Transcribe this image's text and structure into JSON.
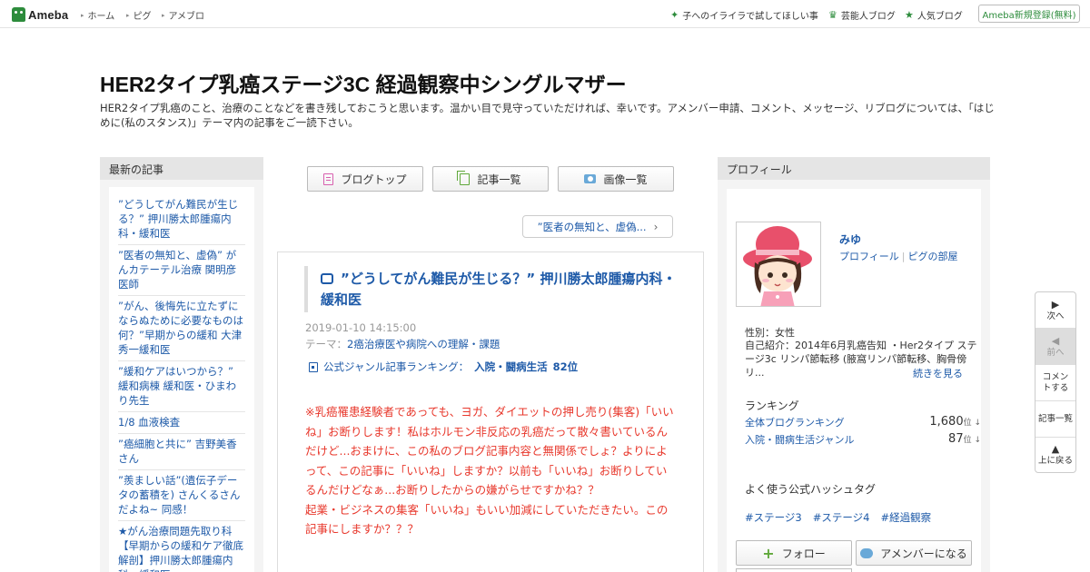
{
  "topbar": {
    "logo": "Ameba",
    "nav": [
      "ホーム",
      "ピグ",
      "アメブロ"
    ],
    "trend_link": "子へのイライラで試してほしい事",
    "geinin_link": "芸能人ブログ",
    "popular_link": "人気ブログ",
    "register": "Ameba新規登録(無料)"
  },
  "header": {
    "title": "HER2タイプ乳癌ステージ3C 経過観察中シングルマザー",
    "description": "HER2タイプ乳癌のこと、治療のことなどを書き残しておこうと思います。温かい目で見守っていただければ、幸いです。アメンバー申請、コメント、メッセージ、リブログについては、「はじめに(私のスタンス)」テーマ内の記事をご一読下さい。"
  },
  "recent": {
    "heading": "最新の記事",
    "items": [
      "”どうしてがん難民が生じる？” 押川勝太郎腫瘍内科・緩和医",
      "”医者の無知と、虚偽” がんカテーテル治療 関明彦医師",
      "”がん、後悔先に立たずにならぬために必要なものは何？”早期からの緩和 大津秀一緩和医",
      "”緩和ケアはいつから？” 緩和病棟 緩和医・ひまわり先生",
      "1/8 血液検査",
      "”癌細胞と共に” 吉野美香さん",
      "”羨ましい話”(遺伝子データの蓄積を) さんくるさんだよね~ 同感！",
      "★がん治療問題先取り科【早期からの緩和ケア徹底解剖】押川勝太郎腫瘍内科・緩和医"
    ]
  },
  "center": {
    "blogtop": "ブログトップ",
    "entrylist": "記事一覧",
    "imagelist": "画像一覧",
    "prev_article": "”医者の無知と、虚偽...",
    "entry": {
      "title": "”どうしてがん難民が生じる？” 押川勝太郎腫瘍内科・緩和医",
      "date": "2019-01-10 14:15:00",
      "theme_label": "テーマ：",
      "theme": "2癌治療医や病院への理解・課題",
      "ranking_label": "公式ジャンル記事ランキング：",
      "ranking_genre": "入院・闘病生活",
      "ranking_rank": "82位",
      "body": "※乳癌罹患経験者であっても、ヨガ、ダイエットの押し売り(集客)「いいね」お断りします！私はホルモン非反応の乳癌だって散々書いているんだけど...おまけに、この私のブログ記事内容と無関係でしょ？よりによって、この記事に「いいね」しますか？以前も「いいね」お断りしているんだけどなぁ...お断りしたからの嫌がらせですかね？？\n起業・ビジネスの集客「いいね」もいい加減にしていただきたい。この記事にしますか？？？"
    }
  },
  "profile": {
    "heading": "プロフィール",
    "name": "みゆ",
    "profile_link": "プロフィール",
    "pig_link": "ピグの部屋",
    "gender": "性別：女性",
    "intro": "自己紹介：2014年6月乳癌告知 ・Her2タイプ ステージ3c リンパ節転移 (腋窩リンパ節転移、胸骨傍リ...",
    "more": "続きを見る",
    "ranking_heading": "ランキング",
    "rank1_label": "全体ブログランキング",
    "rank1_value": "1,680",
    "rank2_label": "入院・闘病生活ジャンル",
    "rank2_value": "87",
    "rank_unit": "位 ↓",
    "hashtag_heading": "よく使う公式ハッシュタグ",
    "hashtags": [
      "#ステージ3",
      "#ステージ4",
      "#経過観察"
    ],
    "follow": "フォロー",
    "member": "アメンバーになる"
  },
  "sidenav": {
    "next": "次へ",
    "prev": "前へ",
    "comment": "コメントする",
    "list": "記事一覧",
    "top": "上に戻る"
  }
}
